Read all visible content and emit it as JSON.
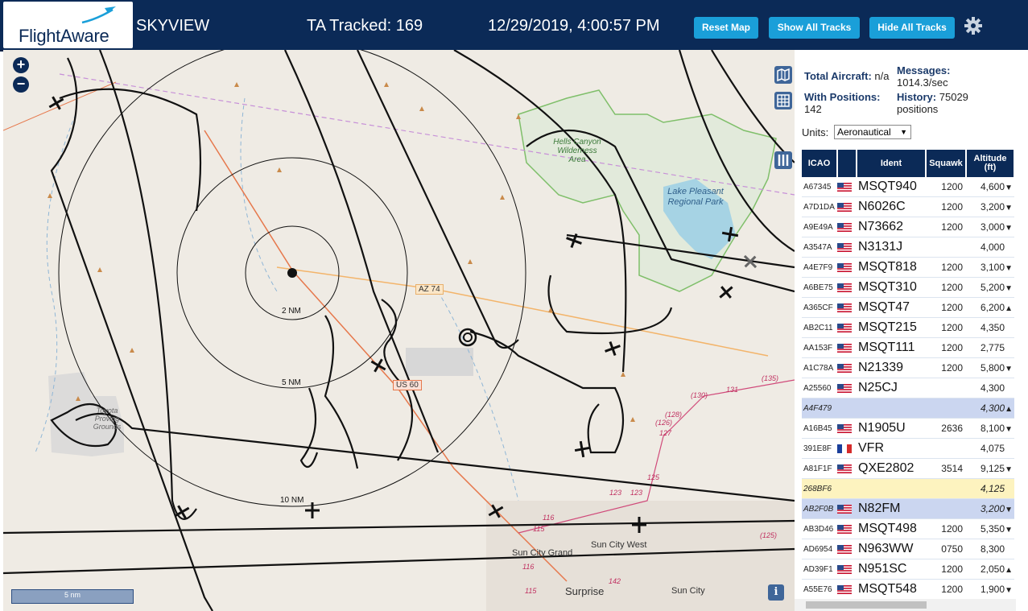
{
  "header": {
    "logo_text": "FlightAware",
    "site_name": "SKYVIEW",
    "ta_tracked": "TA Tracked: 169",
    "datetime": "12/29/2019, 4:00:57 PM",
    "reset_map": "Reset Map",
    "show_all_tracks": "Show All Tracks",
    "hide_all_tracks": "Hide All Tracks",
    "settings_icon": "gear-icon"
  },
  "map": {
    "zoom_in": "+",
    "zoom_out": "−",
    "scale_label": "5 nm",
    "info_icon": "i",
    "ring_labels": [
      "2 NM",
      "5 NM",
      "10 NM"
    ],
    "road_labels": [
      "AZ 74",
      "US 60"
    ],
    "place_labels": {
      "hells_canyon": "Hells Canyon Wilderness Area",
      "lake_pleasant": "Lake Pleasant Regional Park",
      "toyota": "Toyota Proving Grounds",
      "sun_city_grand": "Sun City Grand",
      "sun_city_west": "Sun City West",
      "sun_city": "Sun City",
      "surprise": "Surprise"
    },
    "route_numbers": [
      "(135)",
      "(130)",
      "131",
      "(128)",
      "127",
      "125",
      "(126)",
      "123",
      "123",
      "116",
      "115",
      "142",
      "116",
      "115",
      "(125)"
    ]
  },
  "panel": {
    "total_aircraft_label": "Total Aircraft:",
    "total_aircraft_value": "n/a",
    "messages_label": "Messages:",
    "messages_value": "1014.3/sec",
    "with_positions_label": "With Positions:",
    "with_positions_value": "142",
    "history_label": "History:",
    "history_value": "75029",
    "history_unit": "positions",
    "units_label": "Units:",
    "units_value": "Aeronautical",
    "columns": [
      "ICAO",
      "",
      "Ident",
      "Squawk",
      "Altitude (ft)"
    ],
    "rows": [
      {
        "icao": "A67345",
        "flag": "us",
        "ident": "MSQT940",
        "squawk": "1200",
        "alt": "4,600",
        "trend": "▼",
        "style": ""
      },
      {
        "icao": "A7D1DA",
        "flag": "us",
        "ident": "N6026C",
        "squawk": "1200",
        "alt": "3,200",
        "trend": "▼",
        "style": ""
      },
      {
        "icao": "A9E49A",
        "flag": "us",
        "ident": "N73662",
        "squawk": "1200",
        "alt": "3,000",
        "trend": "▼",
        "style": ""
      },
      {
        "icao": "A3547A",
        "flag": "us",
        "ident": "N3131J",
        "squawk": "",
        "alt": "4,000",
        "trend": "",
        "style": ""
      },
      {
        "icao": "A4E7F9",
        "flag": "us",
        "ident": "MSQT818",
        "squawk": "1200",
        "alt": "3,100",
        "trend": "▼",
        "style": ""
      },
      {
        "icao": "A6BE75",
        "flag": "us",
        "ident": "MSQT310",
        "squawk": "1200",
        "alt": "5,200",
        "trend": "▼",
        "style": ""
      },
      {
        "icao": "A365CF",
        "flag": "us",
        "ident": "MSQT47",
        "squawk": "1200",
        "alt": "6,200",
        "trend": "▲",
        "style": ""
      },
      {
        "icao": "AB2C11",
        "flag": "us",
        "ident": "MSQT215",
        "squawk": "1200",
        "alt": "4,350",
        "trend": "",
        "style": ""
      },
      {
        "icao": "AA153F",
        "flag": "us",
        "ident": "MSQT111",
        "squawk": "1200",
        "alt": "2,775",
        "trend": "",
        "style": ""
      },
      {
        "icao": "A1C78A",
        "flag": "us",
        "ident": "N21339",
        "squawk": "1200",
        "alt": "5,800",
        "trend": "▼",
        "style": ""
      },
      {
        "icao": "A25560",
        "flag": "us",
        "ident": "N25CJ",
        "squawk": "",
        "alt": "4,300",
        "trend": "",
        "style": ""
      },
      {
        "icao": "A4F479",
        "flag": "",
        "ident": "",
        "squawk": "",
        "alt": "4,300",
        "trend": "▲",
        "style": "sel"
      },
      {
        "icao": "A16B45",
        "flag": "us",
        "ident": "N1905U",
        "squawk": "2636",
        "alt": "8,100",
        "trend": "▼",
        "style": ""
      },
      {
        "icao": "391E8F",
        "flag": "fr",
        "ident": "VFR",
        "squawk": "",
        "alt": "4,075",
        "trend": "",
        "style": ""
      },
      {
        "icao": "A81F1F",
        "flag": "us",
        "ident": "QXE2802",
        "squawk": "3514",
        "alt": "9,125",
        "trend": "▼",
        "style": ""
      },
      {
        "icao": "268BF6",
        "flag": "",
        "ident": "",
        "squawk": "",
        "alt": "4,125",
        "trend": "",
        "style": "yel"
      },
      {
        "icao": "AB2F0B",
        "flag": "us",
        "ident": "N82FM",
        "squawk": "",
        "alt": "3,200",
        "trend": "▼",
        "style": "sel"
      },
      {
        "icao": "AB3D46",
        "flag": "us",
        "ident": "MSQT498",
        "squawk": "1200",
        "alt": "5,350",
        "trend": "▼",
        "style": ""
      },
      {
        "icao": "AD6954",
        "flag": "us",
        "ident": "N963WW",
        "squawk": "0750",
        "alt": "8,300",
        "trend": "",
        "style": ""
      },
      {
        "icao": "AD39F1",
        "flag": "us",
        "ident": "N951SC",
        "squawk": "1200",
        "alt": "2,050",
        "trend": "▲",
        "style": ""
      },
      {
        "icao": "A55E76",
        "flag": "us",
        "ident": "MSQT548",
        "squawk": "1200",
        "alt": "1,900",
        "trend": "▼",
        "style": ""
      }
    ]
  }
}
